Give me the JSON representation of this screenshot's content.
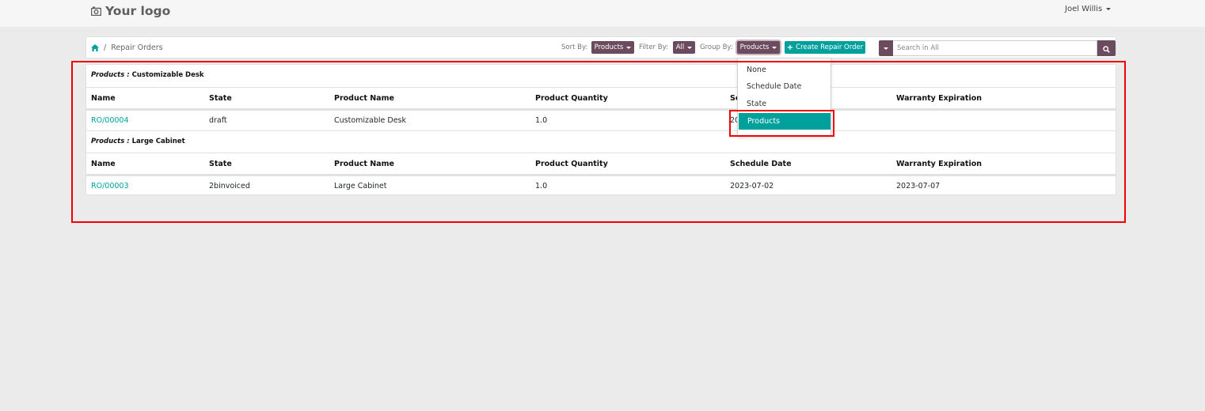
{
  "app": {
    "logo_text": "Your logo",
    "user_name": "Joel Willis"
  },
  "breadcrumb": {
    "page": "Repair Orders"
  },
  "toolbar": {
    "sort_label": "Sort By:",
    "sort_value": "Products",
    "filter_label": "Filter By:",
    "filter_value": "All",
    "group_label": "Group By:",
    "group_value": "Products",
    "create_label": "Create Repair Order",
    "search_placeholder": "Search in All"
  },
  "columns": [
    "Name",
    "State",
    "Product Name",
    "Product Quantity",
    "Schedule Date",
    "Warranty Expiration"
  ],
  "groups": [
    {
      "label_key": "Products :",
      "label_value": "Customizable Desk",
      "rows": [
        {
          "name": "RO/00004",
          "state": "draft",
          "product": "Customizable Desk",
          "qty": "1.0",
          "schedule": "20",
          "warranty": ""
        }
      ]
    },
    {
      "label_key": "Products :",
      "label_value": "Large Cabinet",
      "rows": [
        {
          "name": "RO/00003",
          "state": "2binvoiced",
          "product": "Large Cabinet",
          "qty": "1.0",
          "schedule": "2023-07-02",
          "warranty": "2023-07-07"
        }
      ]
    }
  ],
  "group_menu": {
    "options": [
      "None",
      "Schedule Date",
      "State",
      "Products"
    ],
    "selected": "Products"
  },
  "colors": {
    "primary": "#6c4b5e",
    "accent": "#00a09d",
    "highlight": "#f20000"
  }
}
